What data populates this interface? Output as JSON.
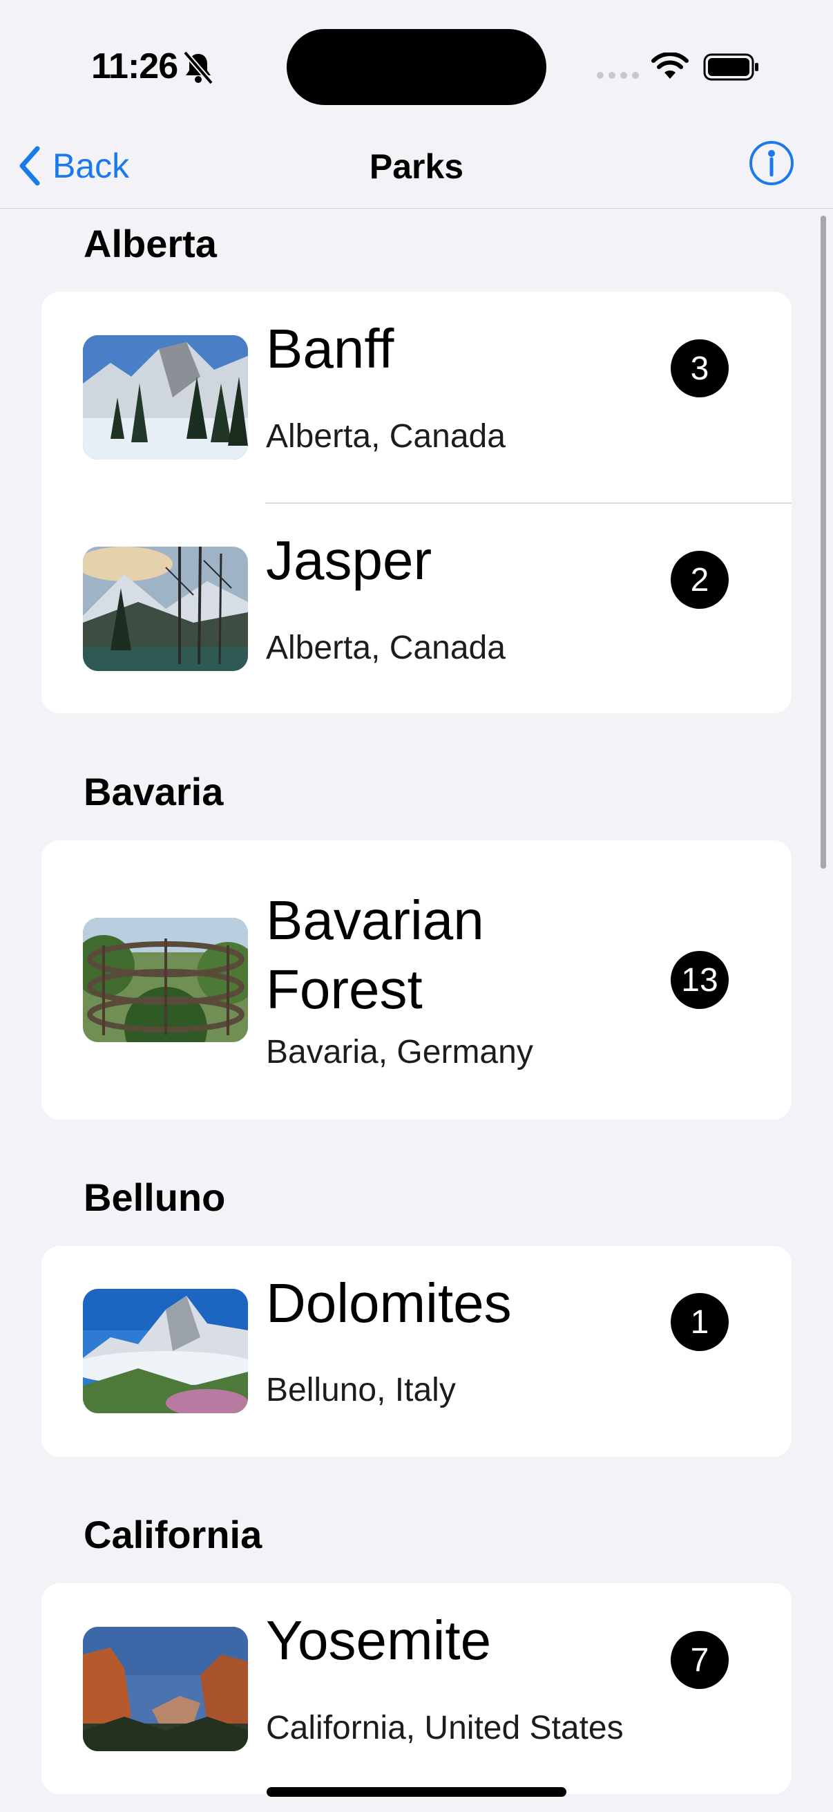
{
  "status_bar": {
    "time": "11:26",
    "icons": [
      "bell-slash-icon",
      "signal-icon",
      "wifi-icon",
      "battery-icon"
    ]
  },
  "nav": {
    "back_label": "Back",
    "title": "Parks",
    "info_icon": "info-icon"
  },
  "accent_color": "#1a7aec",
  "sections": [
    {
      "title": "Alberta",
      "parks": [
        {
          "name": "Banff",
          "location": "Alberta, Canada",
          "count": "3"
        },
        {
          "name": "Jasper",
          "location": "Alberta, Canada",
          "count": "2"
        }
      ]
    },
    {
      "title": "Bavaria",
      "parks": [
        {
          "name": "Bavarian Forest",
          "location": "Bavaria, Germany",
          "count": "13"
        }
      ]
    },
    {
      "title": "Belluno",
      "parks": [
        {
          "name": "Dolomites",
          "location": "Belluno, Italy",
          "count": "1"
        }
      ]
    },
    {
      "title": "California",
      "parks": [
        {
          "name": "Yosemite",
          "location": "California, United States",
          "count": "7"
        }
      ]
    }
  ]
}
